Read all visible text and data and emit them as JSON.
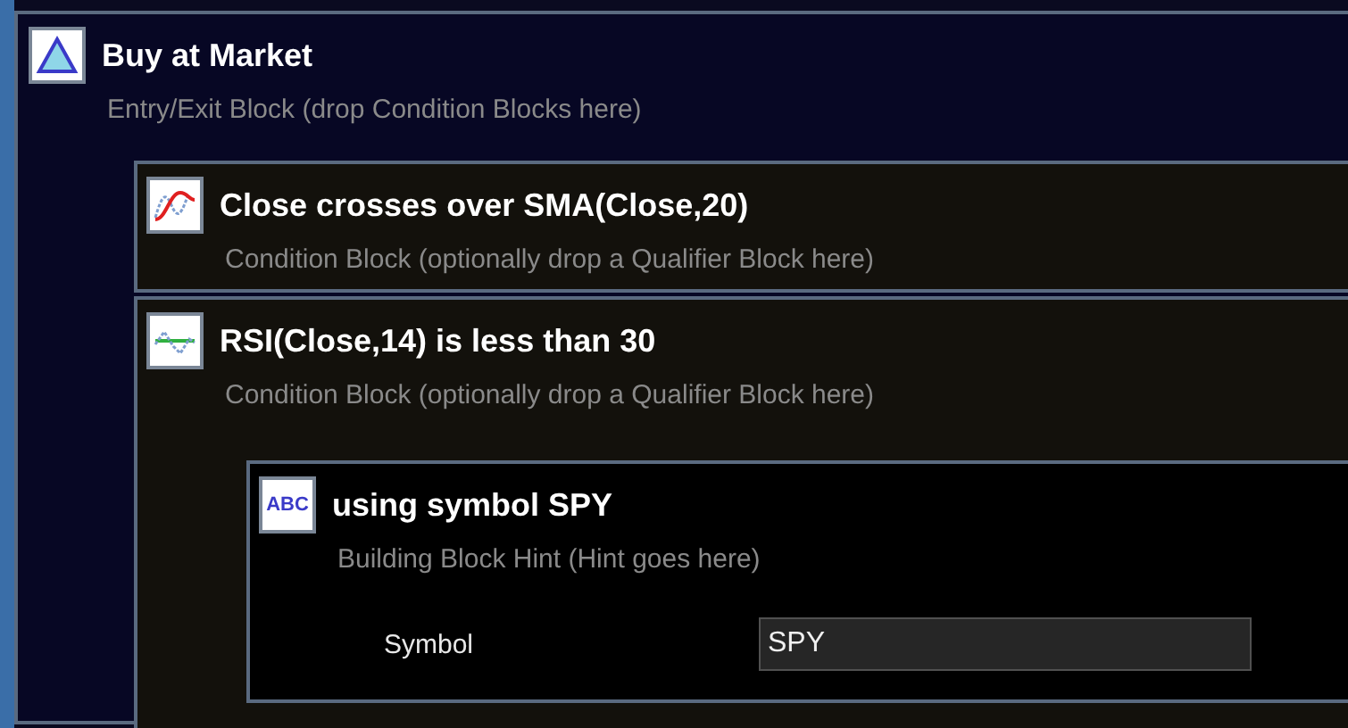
{
  "block": {
    "kind": "entry",
    "title": "Buy at Market",
    "subtitle": "Entry/Exit Block (drop Condition Blocks here)",
    "children": [
      {
        "kind": "crossover",
        "title": "Close crosses over SMA(Close,20)",
        "subtitle": "Condition Block (optionally drop a Qualifier Block here)"
      },
      {
        "kind": "oscillator",
        "title": "RSI(Close,14) is less than 30",
        "subtitle": "Condition Block (optionally drop a Qualifier Block here)",
        "children": [
          {
            "kind": "hint",
            "icon_text": "ABC",
            "title": "using symbol SPY",
            "subtitle": "Building Block Hint (Hint goes here)",
            "fields": [
              {
                "label": "Symbol",
                "value": "SPY"
              }
            ]
          }
        ]
      }
    ]
  }
}
